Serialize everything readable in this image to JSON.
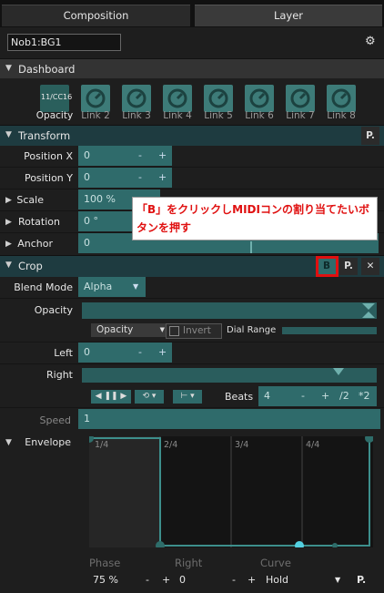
{
  "tabs": {
    "composition": "Composition",
    "layer": "Layer"
  },
  "layer_name": "Nob1:BG1",
  "dashboard": {
    "title": "Dashboard",
    "knobs": [
      {
        "label": "Opacity",
        "badge": "11/CC16"
      },
      {
        "label": "Link 2"
      },
      {
        "label": "Link 3"
      },
      {
        "label": "Link 4"
      },
      {
        "label": "Link 5"
      },
      {
        "label": "Link 6"
      },
      {
        "label": "Link 7"
      },
      {
        "label": "Link 8"
      }
    ]
  },
  "transform": {
    "title": "Transform",
    "p_label": "P.",
    "position_x": {
      "label": "Position X",
      "value": "0",
      "minus": "-",
      "plus": "+"
    },
    "position_y": {
      "label": "Position Y",
      "value": "0",
      "minus": "-",
      "plus": "+"
    },
    "scale": {
      "label": "Scale",
      "value": "100 %"
    },
    "rotation": {
      "label": "Rotation",
      "value": "0 °"
    },
    "anchor": {
      "label": "Anchor",
      "value": "0"
    }
  },
  "callout": {
    "text": "「B」をクリックしMIDIコンの割り当てたいボタンを押す"
  },
  "crop": {
    "title": "Crop",
    "b_label": "B",
    "p_label": "P.",
    "close": "✕"
  },
  "blend_mode": {
    "label": "Blend Mode",
    "value": "Alpha"
  },
  "opacity": {
    "label": "Opacity",
    "dropdown": "Opacity",
    "invert": "Invert",
    "dial_range": "Dial Range"
  },
  "left": {
    "label": "Left",
    "value": "0",
    "minus": "-",
    "plus": "+"
  },
  "right": {
    "label": "Right",
    "beats_label": "Beats",
    "beats_value": "4",
    "minus": "-",
    "plus": "+",
    "div2": "/2",
    "mul2": "*2"
  },
  "speed": {
    "label": "Speed",
    "value": "1"
  },
  "envelope": {
    "label": "Envelope",
    "grid": [
      "1/4",
      "2/4",
      "3/4",
      "4/4"
    ],
    "phase_label": "Phase",
    "right_label": "Right",
    "curve_label": "Curve",
    "phase_value": "75 %",
    "right_value": "0",
    "minus": "-",
    "plus": "+",
    "curve_value": "Hold",
    "p_label": "P."
  },
  "colors": {
    "accent": "#2f6b6b",
    "header_teal": "#1e3b40",
    "highlight": "#e01010"
  }
}
